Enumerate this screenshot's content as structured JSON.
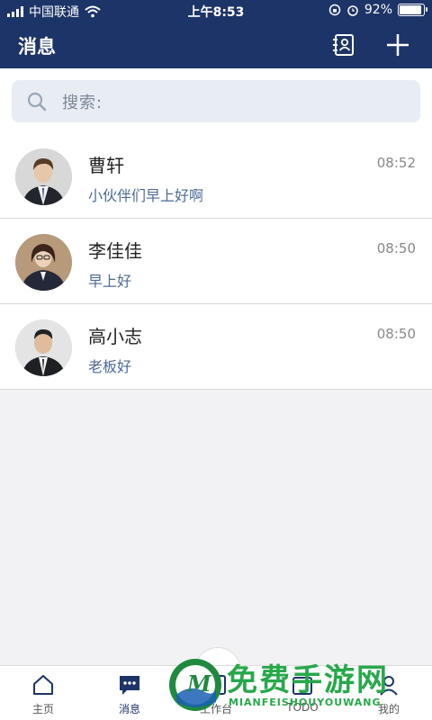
{
  "status_bar": {
    "carrier": "中国联通",
    "time": "上午8:53",
    "battery": "92%",
    "battery_level": 0.92
  },
  "header": {
    "title": "消息",
    "icons": [
      "contacts-icon",
      "plus-icon"
    ]
  },
  "search": {
    "placeholder": "搜索:"
  },
  "conversations": [
    {
      "name": "曹轩",
      "time": "08:52",
      "message": "小伙伴们早上好啊"
    },
    {
      "name": "李佳佳",
      "time": "08:50",
      "message": "早上好"
    },
    {
      "name": "高小志",
      "time": "08:50",
      "message": "老板好"
    }
  ],
  "tabs": [
    {
      "label": "主页",
      "icon": "home-icon"
    },
    {
      "label": "消息",
      "icon": "chat-icon",
      "active": true
    },
    {
      "label": "工作台",
      "icon": "workbench-icon"
    },
    {
      "label": "TODO",
      "icon": "calendar-icon"
    },
    {
      "label": "我的",
      "icon": "profile-icon"
    }
  ],
  "watermark": {
    "logo_letter": "M",
    "title": "免费手游网",
    "subtitle": "MIANFEISHOUYOUWANG"
  },
  "colors": {
    "brand": "#1d3468",
    "link": "#4c6a99",
    "watermark": "#27a84a"
  }
}
